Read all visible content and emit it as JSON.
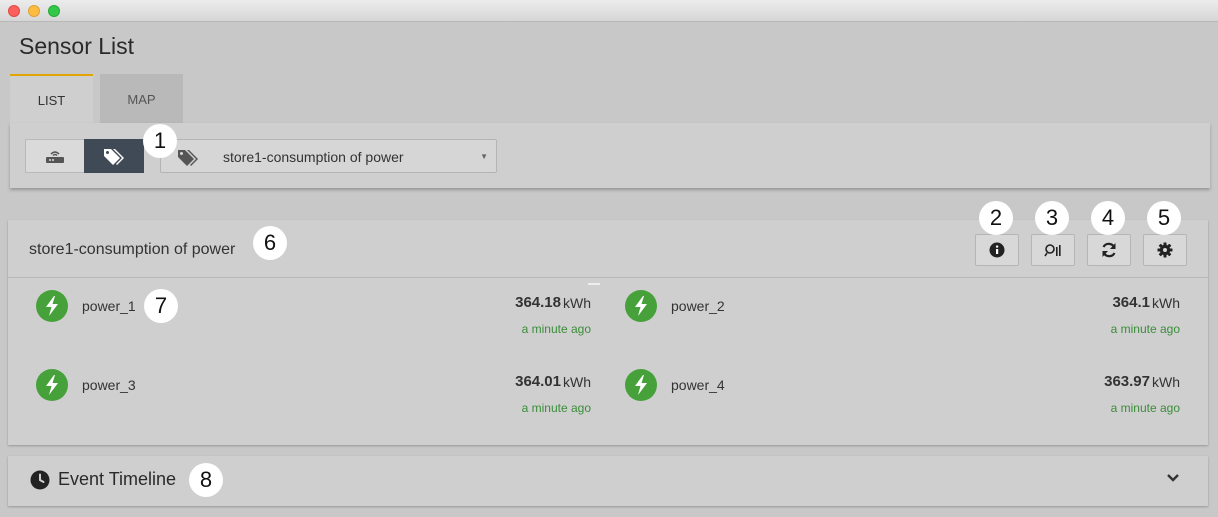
{
  "window": {
    "buttons": [
      "close",
      "minimize",
      "maximize"
    ]
  },
  "page": {
    "title": "Sensor List"
  },
  "tabs": [
    {
      "label": "LIST",
      "active": true
    },
    {
      "label": "MAP",
      "active": false
    }
  ],
  "filter": {
    "gateway_toggle_icon": "router-icon",
    "tag_toggle_icon": "tags-icon",
    "selected_tag": "store1-consumption of power"
  },
  "panel": {
    "title": "store1-consumption of power",
    "actions": [
      {
        "name": "info-icon"
      },
      {
        "name": "chart-search-icon"
      },
      {
        "name": "refresh-icon"
      },
      {
        "name": "gear-icon"
      }
    ],
    "sensors": [
      {
        "name": "power_1",
        "value": "364.18",
        "unit": "kWh",
        "time": "a minute ago"
      },
      {
        "name": "power_2",
        "value": "364.1",
        "unit": "kWh",
        "time": "a minute ago"
      },
      {
        "name": "power_3",
        "value": "364.01",
        "unit": "kWh",
        "time": "a minute ago"
      },
      {
        "name": "power_4",
        "value": "363.97",
        "unit": "kWh",
        "time": "a minute ago"
      }
    ]
  },
  "timeline": {
    "title": "Event Timeline"
  },
  "callouts": [
    "1",
    "2",
    "3",
    "4",
    "5",
    "6",
    "7",
    "8"
  ],
  "colors": {
    "accent_tab": "#e0a500",
    "active_toggle": "#3f4a56",
    "sensor_icon": "#47a13a",
    "timestamp": "#3a8d3a"
  }
}
